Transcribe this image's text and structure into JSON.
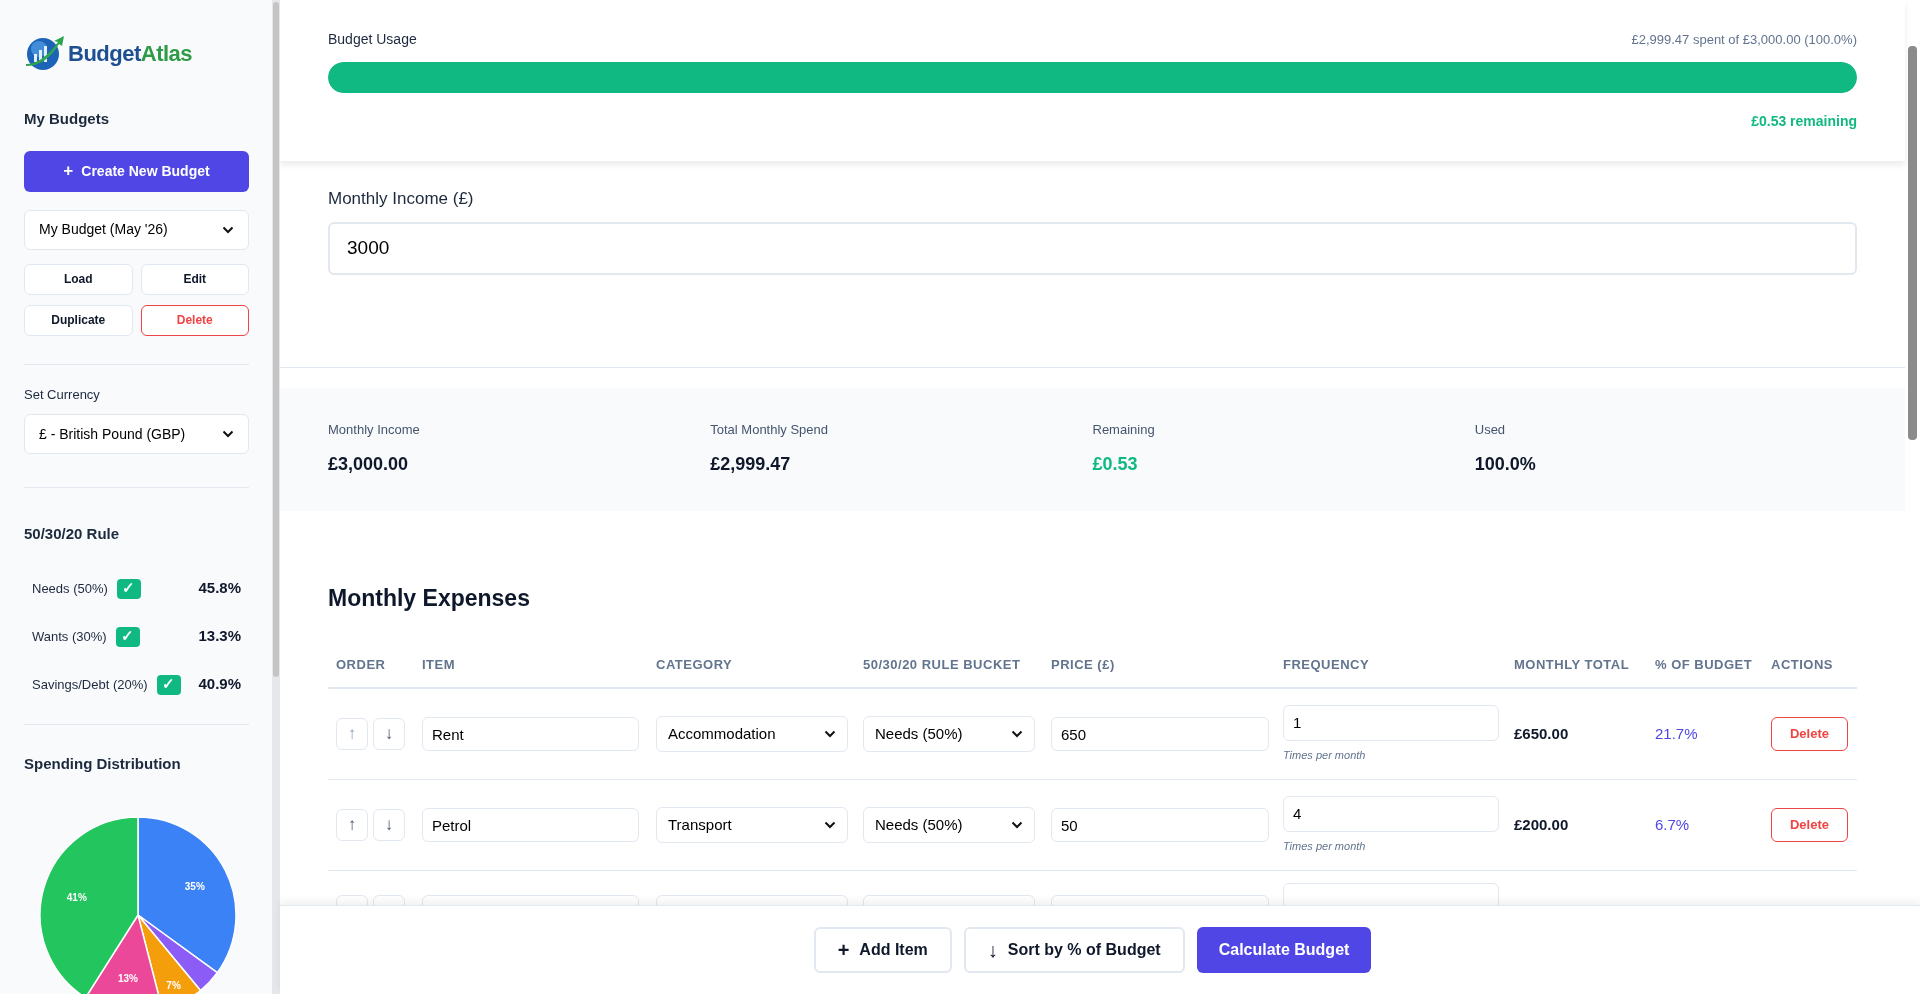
{
  "sidebar": {
    "logo": {
      "first": "Budget",
      "second": "Atlas"
    },
    "budgets_heading": "My Budgets",
    "create_button": {
      "icon": "+",
      "label": "Create New Budget"
    },
    "budget_select": "My Budget (May '26)",
    "budget_actions": [
      {
        "label": "Load",
        "kind": "normal"
      },
      {
        "label": "Edit",
        "kind": "normal"
      },
      {
        "label": "Duplicate",
        "kind": "normal"
      },
      {
        "label": "Delete",
        "kind": "danger"
      }
    ],
    "currency_heading": "Set Currency",
    "currency_select": "£ - British Pound (GBP)",
    "rule_heading": "50/30/20 Rule",
    "rule_rows": [
      {
        "label": "Needs (50%)",
        "mark": "✓",
        "met": true,
        "value": "45.8%"
      },
      {
        "label": "Wants (30%)",
        "mark": "✓",
        "met": true,
        "value": "13.3%"
      },
      {
        "label": "Savings/Debt (20%)",
        "mark": "✓",
        "met": true,
        "value": "40.9%"
      }
    ],
    "distribution_heading": "Spending Distribution",
    "chart_data": {
      "type": "pie",
      "values": [
        35,
        4,
        7,
        13,
        41
      ],
      "colors": [
        "#3b82f6",
        "#8b5cf6",
        "#f59e0b",
        "#ec4899",
        "#22c55e"
      ],
      "value_labels": [
        "35%",
        null,
        "7%",
        "13%",
        "41%"
      ]
    }
  },
  "usage": {
    "title": "Budget Usage",
    "summary": "£2,999.47 spent of £3,000.00 (100.0%)",
    "level": 1,
    "remaining": "£0.53 remaining"
  },
  "income": {
    "label": "Monthly Income (£)",
    "value": "3000"
  },
  "stats": [
    {
      "label": "Monthly Income",
      "value": "£3,000.00",
      "positive": false
    },
    {
      "label": "Total Monthly Spend",
      "value": "£2,999.47",
      "positive": false
    },
    {
      "label": "Remaining",
      "value": "£0.53",
      "positive": true
    },
    {
      "label": "Used",
      "value": "100.0%",
      "positive": false
    }
  ],
  "expenses": {
    "title": "Monthly Expenses",
    "columns": [
      "ORDER",
      "ITEM",
      "CATEGORY",
      "50/30/20 RULE BUCKET",
      "PRICE (£)",
      "FREQUENCY",
      "MONTHLY TOTAL",
      "% OF BUDGET",
      "ACTIONS"
    ],
    "rows": [
      {
        "kind": "full",
        "up": {
          "glyph": "↑",
          "disabled": true
        },
        "down": {
          "glyph": "↓",
          "disabled": false
        },
        "item": "Rent",
        "category": "Accommodation",
        "bucket": "Needs (50%)",
        "price": "650",
        "frequency": "1",
        "frequency_hint": "Times per month",
        "monthly_total": "£650.00",
        "percent": "21.7%",
        "action": "Delete"
      },
      {
        "kind": "full",
        "up": {
          "glyph": "↑",
          "disabled": false
        },
        "down": {
          "glyph": "↓",
          "disabled": false
        },
        "item": "Petrol",
        "category": "Transport",
        "bucket": "Needs (50%)",
        "price": "50",
        "frequency": "4",
        "frequency_hint": "Times per month",
        "monthly_total": "£200.00",
        "percent": "6.7%",
        "action": "Delete"
      },
      {
        "kind": "partial"
      }
    ]
  },
  "footer": {
    "buttons": [
      {
        "icon": "+",
        "label": "Add Item",
        "kind": "secondary"
      },
      {
        "icon": "↓",
        "label": "Sort by % of Budget",
        "kind": "secondary"
      },
      {
        "label": "Calculate Budget",
        "kind": "primary"
      }
    ]
  }
}
